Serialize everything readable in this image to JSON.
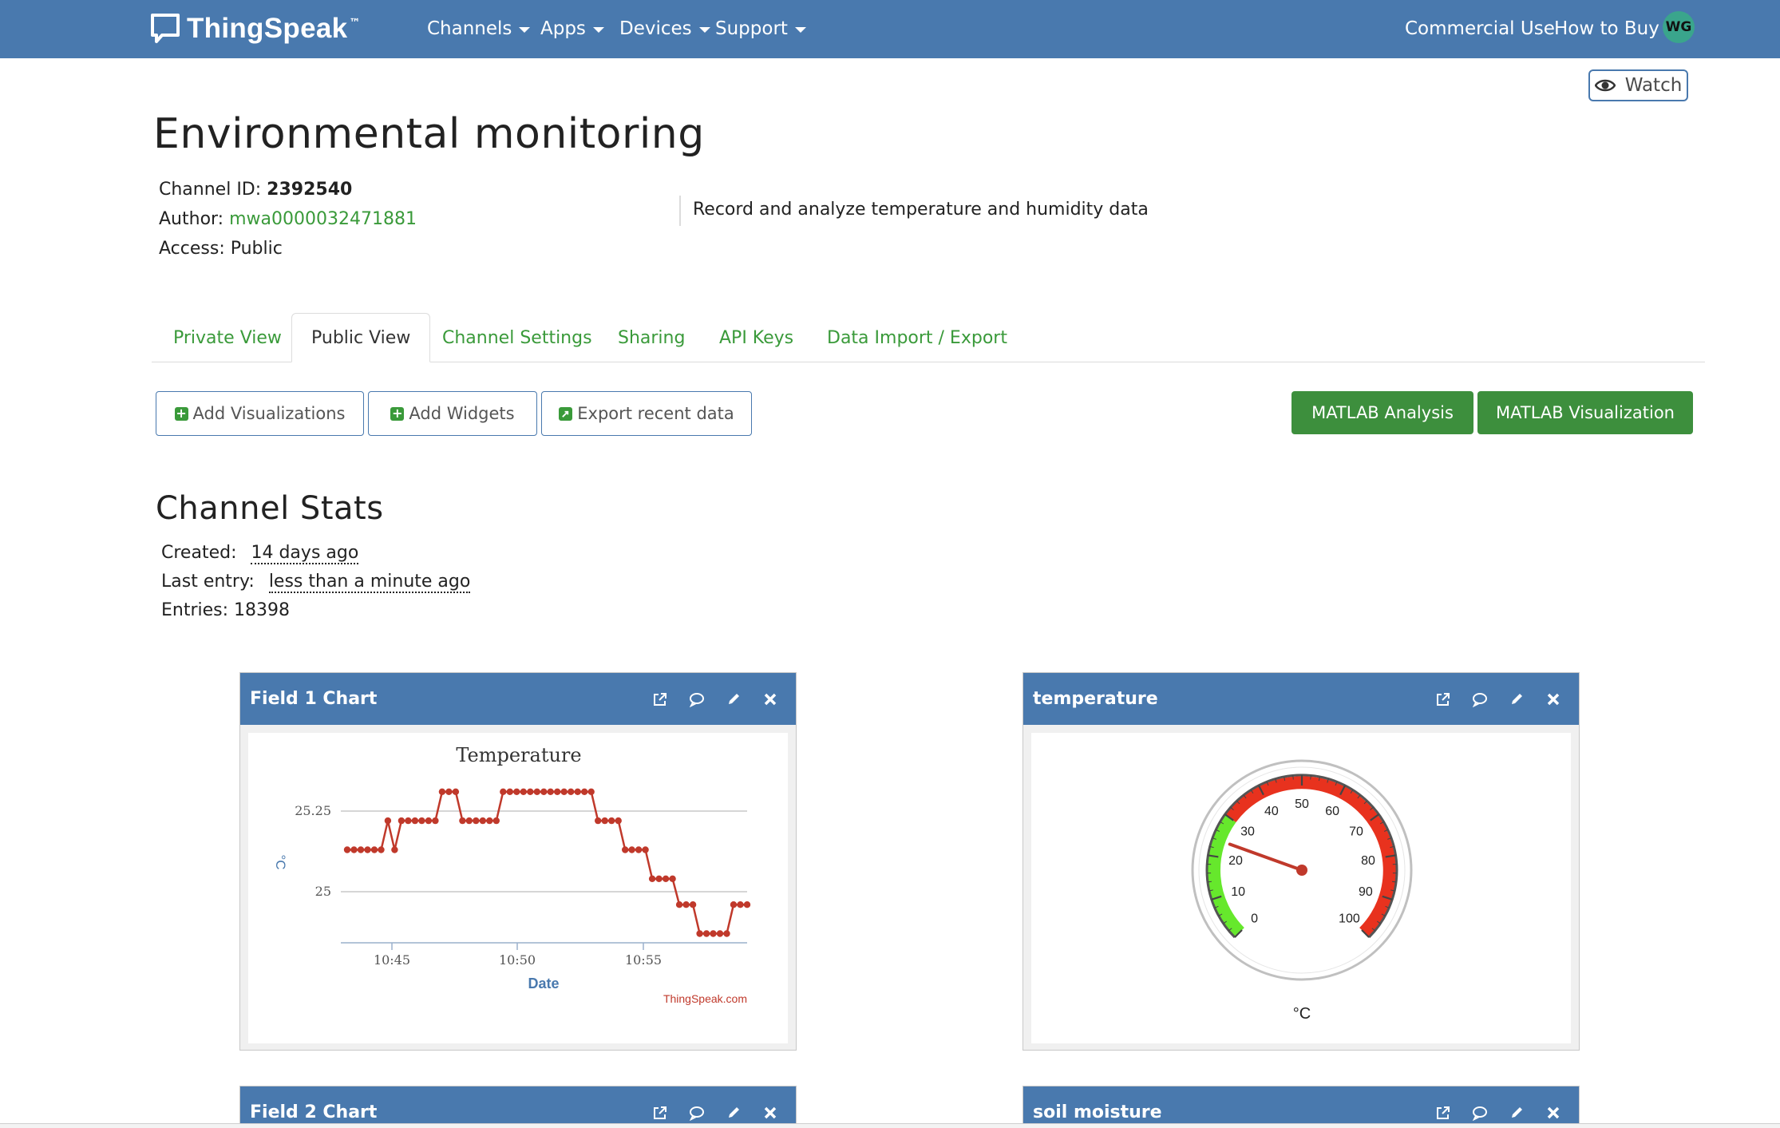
{
  "nav": {
    "brand": "ThingSpeak",
    "brand_tm": "™",
    "menus": [
      "Channels",
      "Apps",
      "Devices",
      "Support"
    ],
    "commercial": "Commercial Use",
    "how_to_buy": "How to Buy",
    "avatar": "WG"
  },
  "watch_label": "Watch",
  "channel": {
    "title": "Environmental monitoring",
    "id_label": "Channel ID: ",
    "id": "2392540",
    "author_label": "Author: ",
    "author": "mwa0000032471881",
    "access": "Access: Public",
    "description": "Record and analyze temperature and humidity data"
  },
  "tabs": [
    "Private View",
    "Public View",
    "Channel Settings",
    "Sharing",
    "API Keys",
    "Data Import / Export"
  ],
  "actions": {
    "add_visualizations": "Add Visualizations",
    "add_widgets": "Add Widgets",
    "export": "Export recent data",
    "matlab_analysis": "MATLAB Analysis",
    "matlab_visualization": "MATLAB Visualization"
  },
  "stats": {
    "title": "Channel Stats",
    "created_label": "Created:",
    "created": "14 days ago",
    "last_entry_label": "Last entry:",
    "last_entry": "less than a minute ago",
    "entries": "Entries: 18398"
  },
  "widgets": {
    "field1": "Field 1 Chart",
    "temperature": "temperature",
    "field2": "Field 2 Chart",
    "soil": "soil moisture"
  },
  "colors": {
    "navbar": "#4979ae",
    "link_green": "#3a9a3a",
    "button_green": "#3d8f3d",
    "series": "#c0392b",
    "gauge_red": "#e8321e",
    "gauge_green": "#66e82c"
  },
  "chart_data": {
    "type": "line",
    "title": "Temperature",
    "xlabel": "Date",
    "ylabel": "°C",
    "credit": "ThingSpeak.com",
    "x_ticks": [
      "10:45",
      "10:50",
      "10:55"
    ],
    "y_ticks": [
      25,
      25.25
    ],
    "series": [
      {
        "values": [
          25.13,
          25.13,
          25.13,
          25.13,
          25.13,
          25.13,
          25.22,
          25.13,
          25.22,
          25.22,
          25.22,
          25.22,
          25.22,
          25.22,
          25.31,
          25.31,
          25.31,
          25.22,
          25.22,
          25.22,
          25.22,
          25.22,
          25.22,
          25.31,
          25.31,
          25.31,
          25.31,
          25.31,
          25.31,
          25.31,
          25.31,
          25.31,
          25.31,
          25.31,
          25.31,
          25.31,
          25.31,
          25.22,
          25.22,
          25.22,
          25.22,
          25.13,
          25.13,
          25.13,
          25.13,
          25.04,
          25.04,
          25.04,
          25.04,
          24.96,
          24.96,
          24.96,
          24.87,
          24.87,
          24.87,
          24.87,
          24.87,
          24.96,
          24.96,
          24.96
        ]
      }
    ]
  },
  "gauge": {
    "value": 24,
    "min": 0,
    "max": 100,
    "unit": "°C",
    "labels": [
      0,
      10,
      20,
      30,
      40,
      50,
      60,
      70,
      80,
      90,
      100
    ],
    "green_range": [
      0,
      30
    ],
    "red_range": [
      30,
      100
    ]
  }
}
